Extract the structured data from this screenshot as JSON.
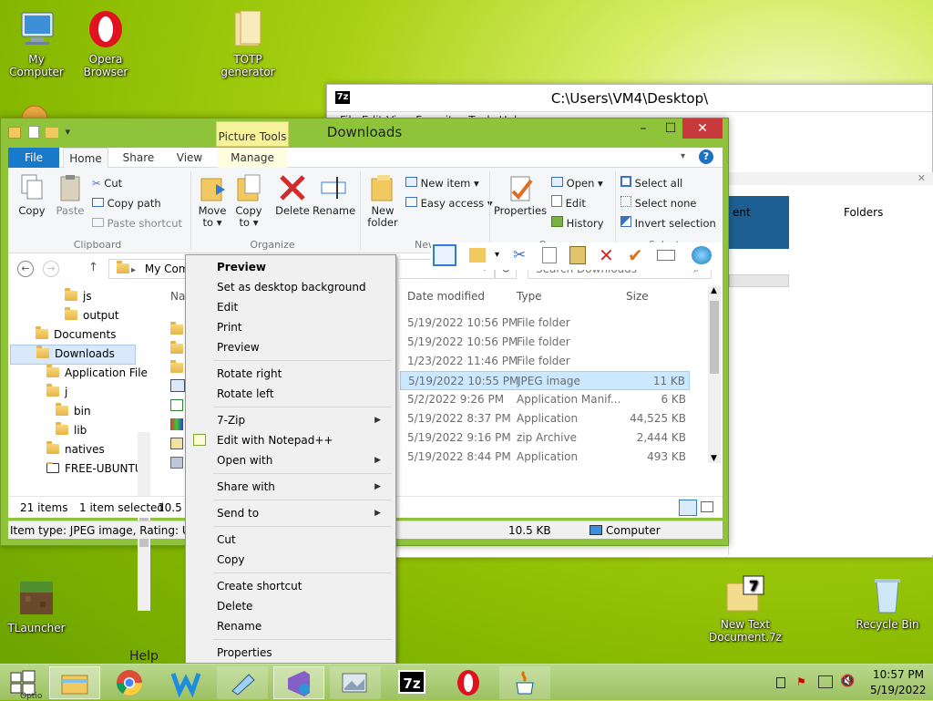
{
  "desktop": {
    "icons": [
      {
        "label": "My Computer"
      },
      {
        "label": "Opera Browser"
      },
      {
        "label": "TOTP generator"
      },
      {
        "label": "TLauncher"
      },
      {
        "label": "New Text Document.7z"
      },
      {
        "label": "Recycle Bin"
      }
    ],
    "help_text": "Help"
  },
  "zip_window": {
    "title": "C:\\Users\\VM4\\Desktop\\",
    "menu": "File   Edit   View   Favorites   Tools   Help",
    "col_ment": "ent",
    "col_folders": "Folders"
  },
  "explorer": {
    "title": "Downloads",
    "context_tab": "Picture Tools",
    "tabs": [
      "File",
      "Home",
      "Share",
      "View",
      "Manage"
    ],
    "clipboard": {
      "copy": "Copy",
      "paste": "Paste",
      "cut": "Cut",
      "copy_path": "Copy path",
      "paste_shortcut": "Paste shortcut",
      "group": "Clipboard"
    },
    "organize": {
      "move_to": "Move to ▾",
      "copy_to": "Copy to ▾",
      "delete": "Delete",
      "rename": "Rename",
      "group": "Organize"
    },
    "new": {
      "new_folder": "New folder",
      "new_item": "New item ▾",
      "easy_access": "Easy access ▾",
      "group": "New"
    },
    "open": {
      "properties": "Properties",
      "open": "Open ▾",
      "edit": "Edit",
      "history": "History",
      "group": "Open"
    },
    "select": {
      "select_all": "Select all",
      "select_none": "Select none",
      "invert": "Invert selection",
      "group": "Select"
    },
    "address": "My Com",
    "search_placeholder": "Search Downloads",
    "tree": [
      {
        "label": "js"
      },
      {
        "label": "output"
      },
      {
        "label": "Documents"
      },
      {
        "label": "Downloads"
      },
      {
        "label": "Application File"
      },
      {
        "label": "j"
      },
      {
        "label": "bin"
      },
      {
        "label": "lib"
      },
      {
        "label": "natives"
      },
      {
        "label": "FREE-UBUNTU"
      }
    ],
    "columns": {
      "name": "Nar",
      "date": "Date modified",
      "type": "Type",
      "size": "Size"
    },
    "rows": [
      {
        "date": "5/19/2022 10:56 PM",
        "type": "File folder",
        "size": ""
      },
      {
        "date": "5/19/2022 10:56 PM",
        "type": "File folder",
        "size": ""
      },
      {
        "date": "1/23/2022 11:46 PM",
        "type": "File folder",
        "size": ""
      },
      {
        "date": "5/19/2022 10:55 PM",
        "type": "JPEG image",
        "size": "11 KB"
      },
      {
        "date": "5/2/2022 9:26 PM",
        "type": "Application Manif...",
        "size": "6 KB"
      },
      {
        "date": "5/19/2022 8:37 PM",
        "type": "Application",
        "size": "44,525 KB"
      },
      {
        "date": "5/19/2022 9:16 PM",
        "type": "zip Archive",
        "size": "2,444 KB"
      },
      {
        "date": "5/19/2022 8:44 PM",
        "type": "Application",
        "size": "493 KB"
      }
    ],
    "status": {
      "items": "21 items",
      "selected": "1 item selected",
      "size_trunc": "10.5 K"
    },
    "info": {
      "left": "Item type: JPEG image, Rating: Unrat",
      "size": "10.5 KB",
      "location": "Computer"
    }
  },
  "context_menu": {
    "items": [
      {
        "label": "Preview",
        "bold": true
      },
      {
        "label": "Set as desktop background"
      },
      {
        "label": "Edit"
      },
      {
        "label": "Print"
      },
      {
        "label": "Preview"
      },
      {
        "label": "Rotate right"
      },
      {
        "label": "Rotate left"
      },
      {
        "label": "7-Zip",
        "submenu": true
      },
      {
        "label": "Edit with Notepad++"
      },
      {
        "label": "Open with",
        "submenu": true
      },
      {
        "label": "Share with",
        "submenu": true
      },
      {
        "label": "Send to",
        "submenu": true
      },
      {
        "label": "Cut"
      },
      {
        "label": "Copy"
      },
      {
        "label": "Create shortcut"
      },
      {
        "label": "Delete"
      },
      {
        "label": "Rename"
      },
      {
        "label": "Properties"
      }
    ]
  },
  "taskbar": {
    "start_label": "Optio",
    "time": "10:57 PM",
    "date": "5/19/2022"
  }
}
